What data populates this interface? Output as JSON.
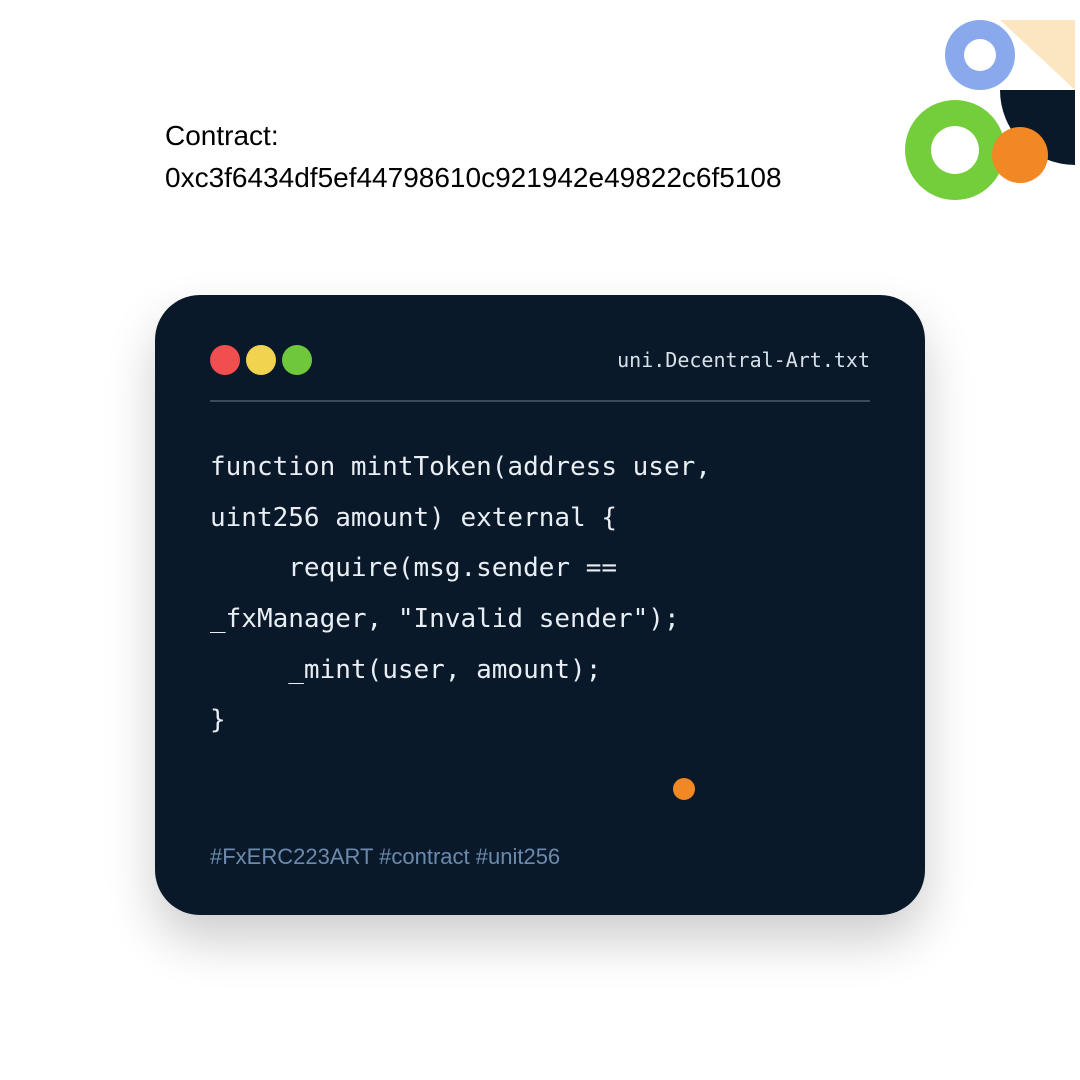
{
  "header": {
    "label": "Contract:",
    "address": "0xc3f6434df5ef44798610c921942e49822c6f5108"
  },
  "window": {
    "filename": "uni.Decentral-Art.txt",
    "code": "function mintToken(address user,\nuint256 amount) external {\n     require(msg.sender ==\n_fxManager, \"Invalid sender\");\n     _mint(user, amount);\n}",
    "hashtags": "#FxERC223ART #contract #unit256"
  },
  "colors": {
    "window_bg": "#0a1929",
    "orange": "#f18823",
    "green": "#6fc73c",
    "blue": "#89a9ec",
    "cream": "#fce5c1",
    "dark_navy": "#0a1929"
  }
}
